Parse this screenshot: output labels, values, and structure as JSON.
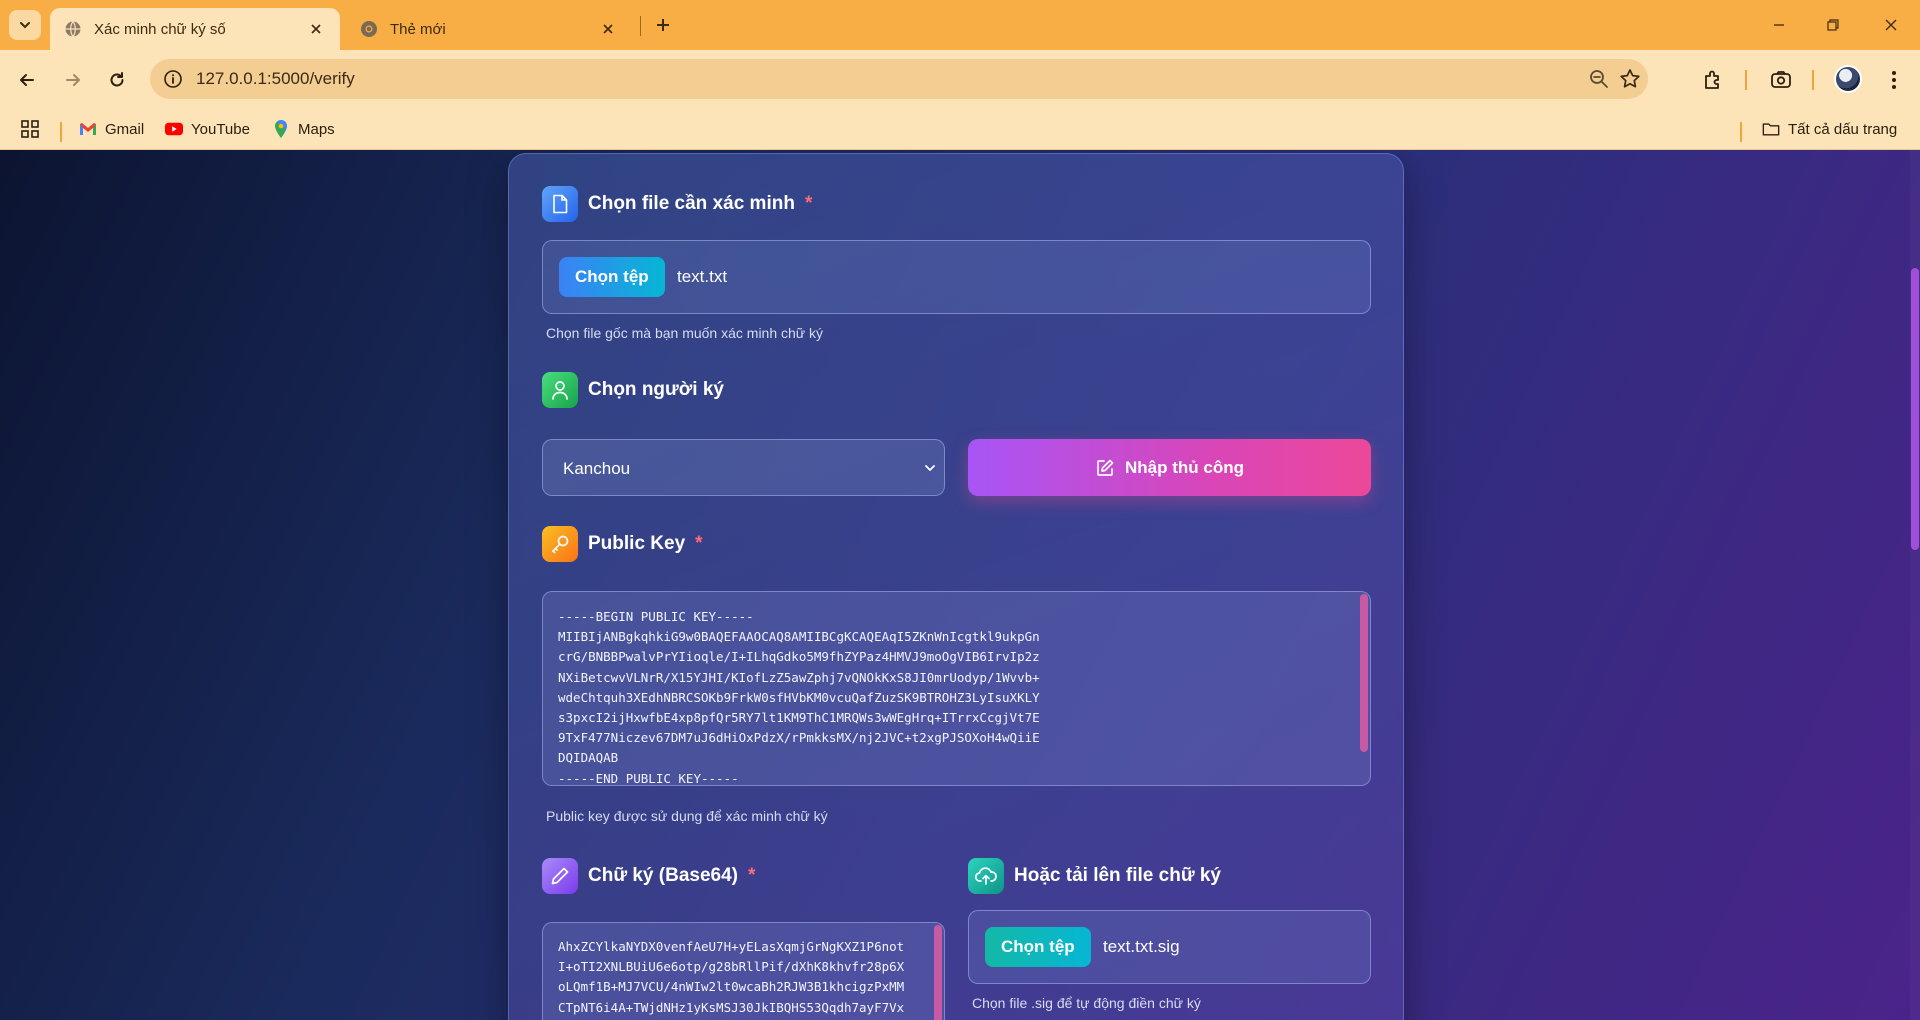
{
  "browser": {
    "tabs": [
      {
        "title": "Xác minh chữ ký số",
        "active": true
      },
      {
        "title": "Thẻ mới",
        "active": false
      }
    ],
    "url": "127.0.0.1:5000/verify",
    "bookmarks": [
      "Gmail",
      "YouTube",
      "Maps"
    ],
    "all_bookmarks": "Tất cả dấu trang"
  },
  "form": {
    "file_section": {
      "label": "Chọn file cần xác minh",
      "required_mark": "*",
      "button": "Chọn tệp",
      "filename": "text.txt",
      "hint": "Chọn file gốc mà bạn muốn xác minh chữ ký"
    },
    "signer_section": {
      "label": "Chọn người ký",
      "selected": "Kanchou",
      "manual_button": "Nhập thủ công"
    },
    "public_key_section": {
      "label": "Public Key",
      "required_mark": "*",
      "value": "-----BEGIN PUBLIC KEY-----\nMIIBIjANBgkqhkiG9w0BAQEFAAOCAQ8AMIIBCgKCAQEAqI5ZKnWnIcgtkl9ukpGn\ncrG/BNBBPwalvPrYIioqle/I+ILhqGdko5M9fhZYPaz4HMVJ9moOgVIB6IrvIp2z\nNXiBetcwvVLNrR/X15YJHI/KIofLzZ5awZphj7vQNOkKxS8JI0mrUodyp/1Wvvb+\nwdeChtquh3XEdhNBRCSOKb9FrkW0sfHVbKM0vcuQafZuzSK9BTROHZ3LyIsuXKLY\ns3pxcI2ijHxwfbE4xp8pfQr5RY7lt1KM9ThC1MRQWs3wWEgHrq+ITrrxCcgjVt7E\n9TxF477Niczev67DM7uJ6dHiOxPdzX/rPmkksMX/nj2JVC+t2xgPJSOXoH4wQiiE\nDQIDAQAB\n-----END PUBLIC KEY-----",
      "hint": "Public key được sử dụng để xác minh chữ ký"
    },
    "signature_section": {
      "label": "Chữ ký (Base64)",
      "required_mark": "*",
      "value": "AhxZCYlkaNYDX0venfAeU7H+yELasXqmjGrNgKXZ1P6not\nI+oTI2XNLBUiU6e6otp/g28bRllPif/dXhK8khvfr28p6X\noLQmf1B+MJ7VCU/4nWIw2lt0wcaBh2RJW3B1khcigzPxMM\nCTpNT6i4A+TWjdNHz1yKsMSJ30JkIBQHS53Qqdh7ayF7Vx"
    },
    "upload_sig_section": {
      "label": "Hoặc tải lên file chữ ký",
      "button": "Chọn tệp",
      "filename": "text.txt.sig",
      "hint": "Chọn file .sig để tự động điền chữ ký"
    }
  },
  "colors": {
    "file_badge": "#3b82f6",
    "signer_badge": "#22c55e",
    "key_badge": "#f59e0b",
    "signature_badge": "#8b5cf6",
    "upload_badge": "#14b8a6",
    "required": "#ff6b7d"
  }
}
